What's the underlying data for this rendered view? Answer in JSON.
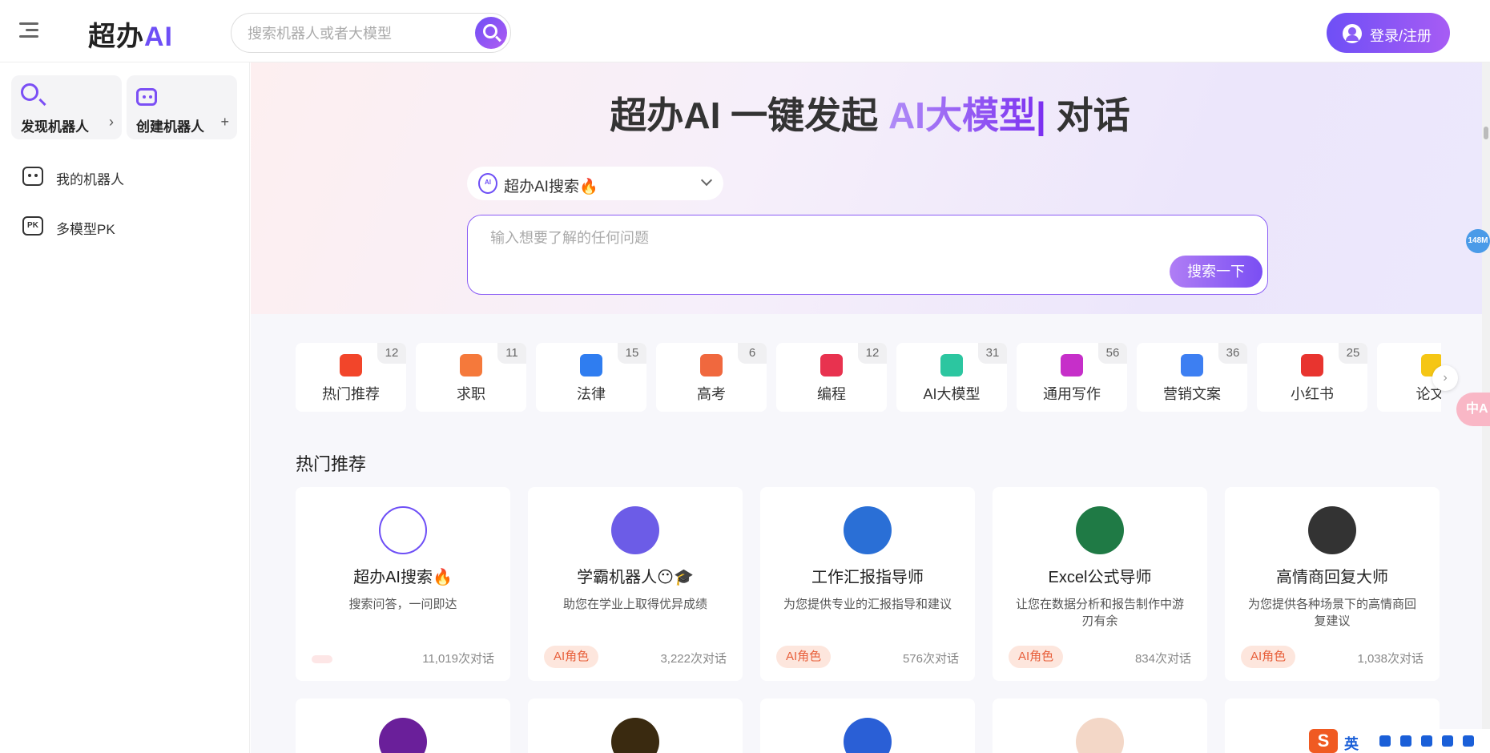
{
  "header": {
    "logo_text": "超办",
    "logo_ai": "AI",
    "search_placeholder": "搜索机器人或者大模型",
    "login_label": "登录/注册"
  },
  "sidebar": {
    "discover_label": "发现机器人",
    "discover_tail": "›",
    "create_label": "创建机器人",
    "create_tail": "+",
    "items": [
      {
        "label": "我的机器人",
        "icon": "robot-icon"
      },
      {
        "label": "多模型PK",
        "icon": "pk-icon"
      }
    ]
  },
  "hero": {
    "title_prefix": "超办AI 一键发起 ",
    "title_highlight": "AI大模型|",
    "title_suffix": " 对话",
    "model_logo_text": "AI",
    "model_label": "超办AI搜索🔥",
    "ask_placeholder": "输入想要了解的任何问题",
    "ask_button": "搜索一下"
  },
  "categories": [
    {
      "name": "热门推荐",
      "count": "12",
      "color": "#f2452a"
    },
    {
      "name": "求职",
      "count": "11",
      "color": "#f5793b"
    },
    {
      "name": "法律",
      "count": "15",
      "color": "#2f7df0"
    },
    {
      "name": "高考",
      "count": "6",
      "color": "#f0683e"
    },
    {
      "name": "编程",
      "count": "12",
      "color": "#e8324f"
    },
    {
      "name": "AI大模型",
      "count": "31",
      "color": "#2cc6a0"
    },
    {
      "name": "通用写作",
      "count": "56",
      "color": "#c62fc9"
    },
    {
      "name": "营销文案",
      "count": "36",
      "color": "#3d7ff2"
    },
    {
      "name": "小红书",
      "count": "25",
      "color": "#e8342f"
    },
    {
      "name": "论文/",
      "count": "",
      "color": "#f5c615"
    }
  ],
  "section": {
    "title": "热门推荐"
  },
  "cards": [
    {
      "name": "超办AI搜索🔥",
      "desc": "搜索问答，一问即达",
      "tag": "",
      "count": "11,019次对话",
      "avatar_color": "#ffffff"
    },
    {
      "name": "学霸机器人😶🎓",
      "desc": "助您在学业上取得优异成绩",
      "tag": "AI角色",
      "count": "3,222次对话",
      "avatar_color": "#6c5ce7"
    },
    {
      "name": "工作汇报指导师",
      "desc": "为您提供专业的汇报指导和建议",
      "tag": "AI角色",
      "count": "576次对话",
      "avatar_color": "#2a6fd6"
    },
    {
      "name": "Excel公式导师",
      "desc": "让您在数据分析和报告制作中游刃有余",
      "tag": "AI角色",
      "count": "834次对话",
      "avatar_color": "#1f7a45"
    },
    {
      "name": "高情商回复大师",
      "desc": "为您提供各种场景下的高情商回复建议",
      "tag": "AI角色",
      "count": "1,038次对话",
      "avatar_color": "#333333"
    }
  ],
  "cards_row2": [
    {
      "avatar_color": "#6a1f9a"
    },
    {
      "avatar_color": "#3a2a10"
    },
    {
      "avatar_color": "#2a5fd6"
    },
    {
      "avatar_color": "#f3d7c7"
    },
    {
      "avatar_color": "#ffffff"
    }
  ],
  "floating": {
    "badge": "148M",
    "translate": "中A"
  },
  "ime": {
    "logo": "S",
    "mode": "英"
  }
}
